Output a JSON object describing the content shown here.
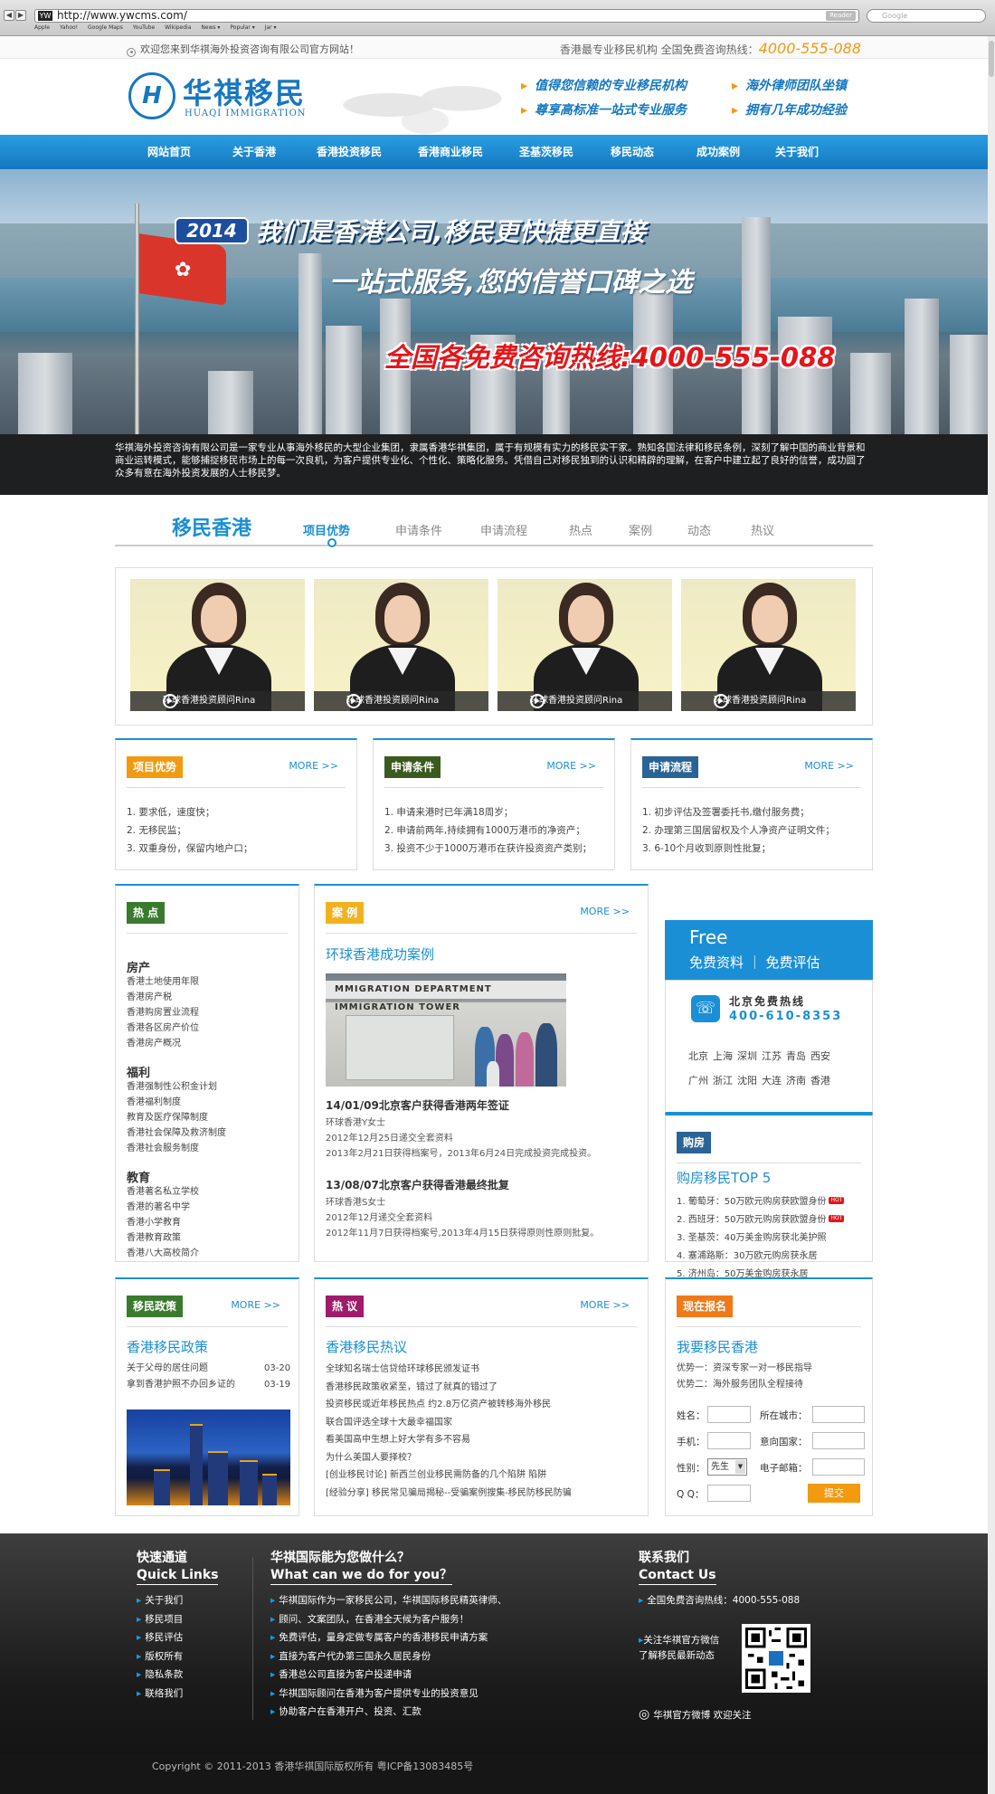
{
  "browser": {
    "url": "http://www.ywcms.com/",
    "reader_label": "Reader",
    "search_placeholder": "Google",
    "bookmarks": [
      "Apple",
      "Yahoo!",
      "Google Maps",
      "YouTube",
      "Wikipedia",
      "News ▾",
      "Popular ▾",
      "Jar ▾"
    ]
  },
  "topbar": {
    "welcome": "欢迎您来到华祺海外投资咨询有限公司官方网站！",
    "hotline_label": "香港最专业移民机构  全国免费咨询热线：",
    "hotline_number": "4000-555-088"
  },
  "logo": {
    "mark": "H",
    "cn": "华祺移民",
    "en": "HUAQI IMMIGRATION"
  },
  "slogans": [
    "值得您信赖的专业移民机构",
    "海外律师团队坐镇",
    "尊享高标准一站式专业服务",
    "拥有几年成功经验"
  ],
  "nav": [
    "网站首页",
    "关于香港",
    "香港投资移民",
    "香港商业移民",
    "圣基茨移民",
    "移民动态",
    "成功案例",
    "关于我们"
  ],
  "banner": {
    "year": "2014",
    "line1": "我们是香港公司,移民更快捷更直接",
    "line2": "一站式服务,您的信誉口碑之选",
    "line3": "全国各免费咨询热线:4000-555-088"
  },
  "intro": "华祺海外投资咨询有限公司是一家专业从事海外移民的大型企业集团，隶属香港华祺集团，属于有规模有实力的移民实干家。熟知各国法律和移民条例，深刻了解中国的商业背景和商业运转模式，能够捕捉移民市场上的每一次良机，为客户提供专业化、个性化、策略化服务。凭借自己对移民独到的认识和精辟的理解，在客户中建立起了良好的信誉，成功圆了众多有意在海外投资发展的人士移民梦。",
  "section": {
    "title": "移民香港",
    "tabs": [
      "项目优势",
      "申请条件",
      "申请流程",
      "热点",
      "案例",
      "动态",
      "热议"
    ]
  },
  "videos": [
    "环球香港投资顾问Rina",
    "环球香港投资顾问Rina",
    "环球香港投资顾问Rina",
    "环球香港投资顾问Rina"
  ],
  "more": "MORE >>",
  "info_boxes": [
    {
      "tag": "项目优势",
      "color": "#f29a10",
      "items": [
        "1. 要求低，速度快；",
        "2. 无移民监；",
        "3. 双重身份，保留内地户口；"
      ]
    },
    {
      "tag": "申请条件",
      "color": "#3a5a1e",
      "items": [
        "1. 申请来港时已年满18周岁；",
        "2. 申请前两年,持续拥有1000万港币的净资产；",
        "3. 投资不少于1000万港币在获许投资资产类别；"
      ]
    },
    {
      "tag": "申请流程",
      "color": "#2a6496",
      "items": [
        "1. 初步评估及签署委托书,缴付服务费；",
        "2. 办理第三国居留权及个人净资产证明文件；",
        "3. 6-10个月收到原则性批复；"
      ]
    }
  ],
  "hot": {
    "tag": "热 点",
    "groups": [
      {
        "title": "房产",
        "items": [
          "香港土地使用年限",
          "香港房产税",
          "香港购房置业流程",
          "香港各区房产价位",
          "香港房产概况"
        ]
      },
      {
        "title": "福利",
        "items": [
          "香港强制性公积金计划",
          "香港福利制度",
          "教育及医疗保障制度",
          "香港社会保障及救济制度",
          "香港社会服务制度"
        ]
      },
      {
        "title": "教育",
        "items": [
          "香港著名私立学校",
          "香港的著名中学",
          "香港小学教育",
          "香港教育政策",
          "香港八大高校简介"
        ]
      }
    ]
  },
  "cases": {
    "tag": "案 例",
    "subtitle": "环球香港成功案例",
    "photo_sign": "IMMIGRATION TOWER",
    "photo_sign2": "MMIGRATION DEPARTMENT",
    "items": [
      {
        "title": "14/01/09北京客户获得香港两年签证",
        "lines": [
          "环球香港Y女士",
          "2012年12月25日递交全套资料",
          "2013年2月21日获得档案号，2013年6月24日完成投资完成投资。"
        ]
      },
      {
        "title": "13/08/07北京客户获得香港最终批复",
        "lines": [
          "环球香港S女士",
          "2012年12月递交全套资料",
          "2012年11月7日获得档案号,2013年4月15日获得原则性原则批复。"
        ]
      }
    ]
  },
  "free": {
    "en": "Free",
    "cn": "免费资料  ｜  免费评估"
  },
  "hotline": {
    "title": "北京免费热线",
    "number": "400-610-8353",
    "cities": [
      "北京",
      "上海",
      "深圳",
      "江苏",
      "青岛",
      "西安",
      "广州",
      "浙江",
      "沈阳",
      "大连",
      "济南",
      "香港"
    ]
  },
  "house": {
    "tag": "购房",
    "subtitle": "购房移民TOP 5",
    "items": [
      "1. 葡萄牙：50万欧元购房获欧盟身份",
      "2. 西班牙：50万欧元购房获欧盟身份",
      "3. 圣基茨：40万美金购房获北美护照",
      "4. 塞浦路斯：30万欧元购房获永居",
      "5. 济州岛：50万美金购房获永居"
    ],
    "hot_label": "HOT"
  },
  "policy": {
    "tag": "移民政策",
    "subtitle": "香港移民政策",
    "items": [
      {
        "text": "关于父母的居住问题",
        "date": "03-20"
      },
      {
        "text": "拿到香港护照不办回乡证的",
        "date": "03-19"
      }
    ]
  },
  "discuss": {
    "tag": "热 议",
    "subtitle": "香港移民热议",
    "items": [
      "全球知名瑞士信贷给环球移民颁发证书",
      "香港移民政策收紧至，错过了就真的错过了",
      "投资移民或近年移民热点 约2.8万亿资产被转移海外移民",
      "联合国评选全球十大最幸福国家",
      "看美国高中生想上好大学有多不容易",
      "为什么美国人要择校？",
      "[创业移民讨论] 新西兰创业移民需防备的几个陷阱    陷阱",
      "[经验分享] 移民常见骗局揭秘--受骗案例搜集-移民防移民防骗"
    ]
  },
  "signup": {
    "tag": "现在报名",
    "subtitle": "我要移民香港",
    "adv1": "优势一：资深专家一对一移民指导",
    "adv2": "优势二：海外服务团队全程接待",
    "fields": {
      "name": "姓名：",
      "city": "所在城市：",
      "phone": "手机：",
      "country": "意向国家：",
      "gender": "性别：",
      "email": "电子邮箱：",
      "qq": "Q Q："
    },
    "gender_value": "先生",
    "submit": "提交"
  },
  "footer": {
    "quick_cn": "快速通道",
    "quick_en": "Quick Links",
    "quick_items": [
      "关于我们",
      "移民项目",
      "移民评估",
      "版权所有",
      "隐私条款",
      "联络我们"
    ],
    "what_cn": "华祺国际能为您做什么？",
    "what_en": "What can we do for you？",
    "what_items": [
      "华祺国际作为一家移民公司，华祺国际移民精英律师、",
      "顾问、文案团队，在香港全天候为客户服务！",
      "免费评估，量身定做专属客户的香港移民申请方案",
      "直接为客户代办第三国永久居民身份",
      "香港总公司直接为客户投递申请",
      "华祺国际顾问在香港为客户提供专业的投资意见",
      "协助客户在香港开户、投资、汇款"
    ],
    "contact_cn": "联系我们",
    "contact_en": "Contact Us",
    "contact_hotline": "全国免费咨询热线：4000-555-088",
    "wechat_l1": "关注华祺官方微信",
    "wechat_l2": "了解移民最新动态",
    "weibo": "华祺官方微博 欢迎关注"
  },
  "copyright": "Copyright © 2011-2013 香港华祺国际版权所有  粤ICP备13083485号"
}
